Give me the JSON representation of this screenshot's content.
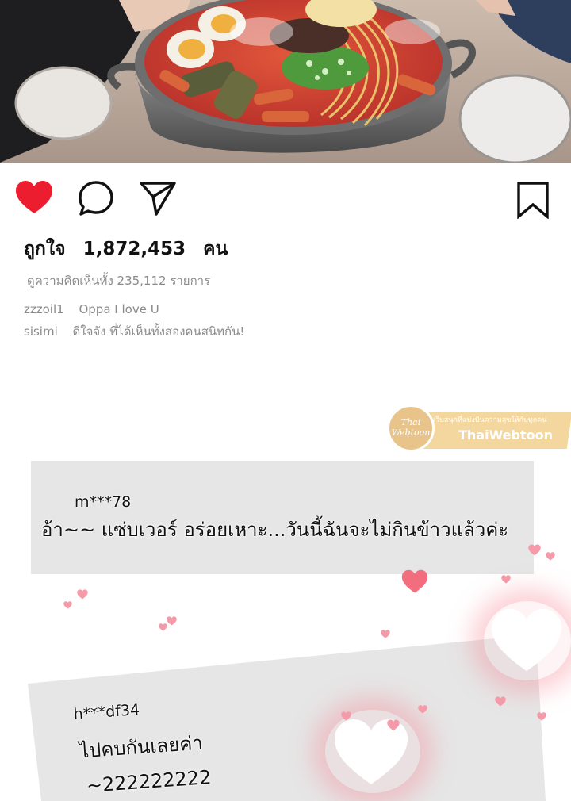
{
  "post": {
    "likes_label": "ถูกใจ",
    "likes_count": "1,872,453",
    "likes_unit": "คน",
    "view_comments": "ดูความคิดเห็นทั้ง 235,112 รายการ",
    "captions": [
      {
        "user": "zzzoil1",
        "text": "Oppa I love U"
      },
      {
        "user": "sisimi",
        "text": "ดีใจจัง ที่ได้เห็นทั้งสองคนสนิทกัน!"
      }
    ]
  },
  "actions": {
    "like_icon": "heart-filled-icon",
    "comment_icon": "speech-bubble-icon",
    "share_icon": "paper-plane-icon",
    "save_icon": "bookmark-icon",
    "like_color": "#ed1d30"
  },
  "watermark": {
    "logo": "Thai Webtoon",
    "tagline": "เว็บสนุกที่แบ่งปันความสุขให้กับทุกคน",
    "brand": "ThaiWebtoon"
  },
  "comments": [
    {
      "user": "m***78",
      "text": "อ้า~~ แซ่บเวอร์ อร่อยเหาะ...วันนี้ฉันจะไม่กินข้าวแล้วค่ะ"
    },
    {
      "user": "h***df34",
      "text": "ไปคบกันเลยค่า",
      "text2": "~222222222"
    }
  ],
  "colors": {
    "heart_pink": "#f49aa8",
    "heart_red": "#f26d7d",
    "bubble": "#e6e6e6"
  }
}
